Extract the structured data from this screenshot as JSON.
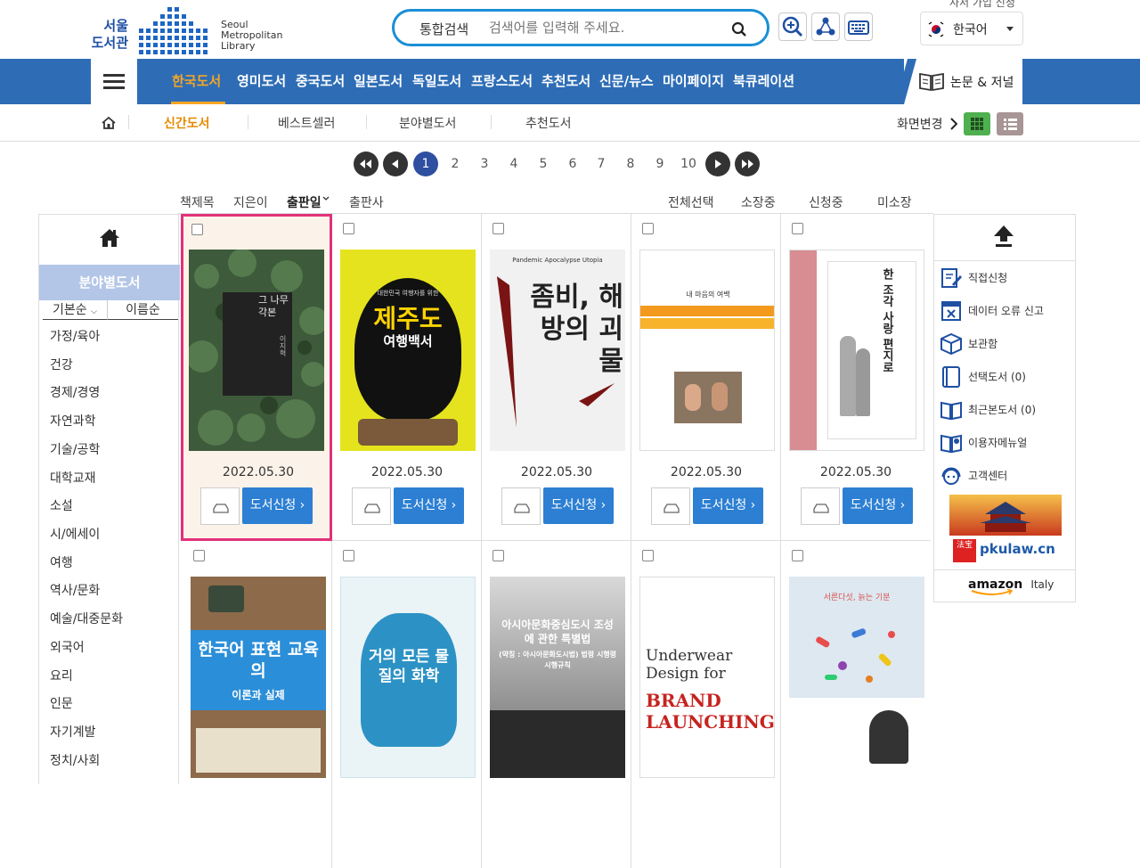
{
  "header": {
    "logo_kr_line1": "서울",
    "logo_kr_line2": "도서관",
    "logo_en_line1": "Seoul",
    "logo_en_line2": "Metropolitan",
    "logo_en_line3": "Library",
    "member_link": "사서 가입 신청",
    "search": {
      "label": "통합검색",
      "placeholder": "검색어를 입력해 주세요."
    },
    "language": "한국어"
  },
  "nav": {
    "items": [
      "한국도서",
      "영미도서",
      "중국도서",
      "일본도서",
      "독일도서",
      "프랑스도서",
      "추천도서",
      "신문/뉴스",
      "마이페이지",
      "북큐레이션"
    ],
    "active_index": 0,
    "journal": "논문 & 저널"
  },
  "subnav": {
    "items": [
      "신간도서",
      "베스트셀러",
      "분야별도서",
      "추천도서"
    ],
    "active_index": 0,
    "view_label": "화면변경"
  },
  "pagination": {
    "pages": [
      "1",
      "2",
      "3",
      "4",
      "5",
      "6",
      "7",
      "8",
      "9",
      "10"
    ],
    "current": "1"
  },
  "sort": {
    "left": [
      "책제목",
      "지은이",
      "출판일",
      "출판사"
    ],
    "active": "출판일",
    "right": [
      "전체선택",
      "소장중",
      "신청중",
      "미소장"
    ]
  },
  "sidebar": {
    "category_title": "분야별도서",
    "order_options": [
      "기본순",
      "이름순"
    ],
    "categories": [
      "가정/육아",
      "건강",
      "경제/경영",
      "자연과학",
      "기술/공학",
      "대학교재",
      "소설",
      "시/에세이",
      "여행",
      "역사/문화",
      "예술/대중문화",
      "외국어",
      "요리",
      "인문",
      "자기계발",
      "정치/사회"
    ]
  },
  "books": [
    {
      "date": "2022.05.30",
      "button": "도서신청",
      "cover_title": "그 나무 각본",
      "cover_author": "이지혁"
    },
    {
      "date": "2022.05.30",
      "button": "도서신청",
      "cover_title": "제주도",
      "cover_sub": "여행백서",
      "cover_top": "대한민국 여행자를 위한"
    },
    {
      "date": "2022.05.30",
      "button": "도서신청",
      "cover_top": "Pandemic  Apocalypse  Utopia",
      "cover_title": "좀비, 해방의 괴물"
    },
    {
      "date": "2022.05.30",
      "button": "도서신청",
      "cover_title": "내 마음의 여백"
    },
    {
      "date": "2022.05.30",
      "button": "도서신청",
      "cover_title": "한 조각 사랑 편지로"
    },
    {
      "cover_title": "한국어 표현 교육의",
      "cover_sub": "이론과 실제"
    },
    {
      "cover_title": "거의 모든 물질의 화학"
    },
    {
      "cover_title": "아시아문화중심도시 조성에 관한 특별법",
      "cover_sub": "(약칭 : 아시아문화도시법) 법령 시행령 시행규칙"
    },
    {
      "cover_title": "Underwear Design for",
      "cover_sub": "BRAND LAUNCHING"
    },
    {
      "cover_title": "서른다섯, 늙는 기분"
    }
  ],
  "right_menu": {
    "items": [
      "직접신청",
      "데이터 오류 신고",
      "보관함",
      "선택도서 (0)",
      "최근본도서 (0)",
      "이용자메뉴얼",
      "고객센터"
    ],
    "ad1": "pkulaw.cn",
    "ad1_stamp": "法宝",
    "ad2_brand": "amazon",
    "ad2_region": "Italy"
  }
}
